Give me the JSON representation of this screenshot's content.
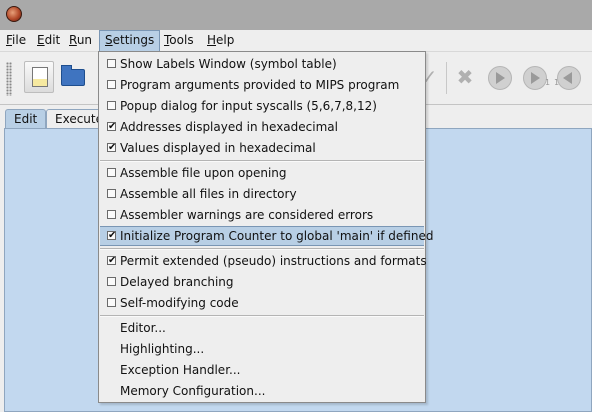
{
  "menubar": {
    "items": [
      {
        "label": "File",
        "mnemonic": "F",
        "rest": "ile"
      },
      {
        "label": "Edit",
        "mnemonic": "E",
        "rest": "dit"
      },
      {
        "label": "Run",
        "mnemonic": "R",
        "rest": "un"
      },
      {
        "label": "Settings",
        "mnemonic": "S",
        "rest": "ettings"
      },
      {
        "label": "Tools",
        "mnemonic": "T",
        "rest": "ools"
      },
      {
        "label": "Help",
        "mnemonic": "H",
        "rest": "elp"
      }
    ]
  },
  "toolbar": {
    "step_subscript_1": "1",
    "step_subscript_2": "1"
  },
  "tabs": [
    {
      "label": "Edit",
      "selected": true
    },
    {
      "label": "Execute",
      "selected": false
    }
  ],
  "settings_menu": {
    "group1": [
      {
        "label": "Show Labels Window (symbol table)",
        "checked": false
      },
      {
        "label": "Program arguments provided to MIPS program",
        "checked": false
      },
      {
        "label": "Popup dialog for input syscalls (5,6,7,8,12)",
        "checked": false
      },
      {
        "label": "Addresses displayed in hexadecimal",
        "checked": true
      },
      {
        "label": "Values displayed in hexadecimal",
        "checked": true
      }
    ],
    "group2": [
      {
        "label": "Assemble file upon opening",
        "checked": false
      },
      {
        "label": "Assemble all files in directory",
        "checked": false
      },
      {
        "label": "Assembler warnings are considered errors",
        "checked": false
      },
      {
        "label": "Initialize Program Counter to global 'main' if defined",
        "checked": true,
        "highlighted": true
      }
    ],
    "group3": [
      {
        "label": "Permit extended (pseudo) instructions and formats",
        "checked": true
      },
      {
        "label": "Delayed branching",
        "checked": false
      },
      {
        "label": "Self-modifying code",
        "checked": false
      }
    ],
    "group4": [
      {
        "label": "Editor..."
      },
      {
        "label": "Highlighting..."
      },
      {
        "label": "Exception Handler..."
      },
      {
        "label": "Memory Configuration..."
      }
    ]
  },
  "check_mark": "✔",
  "colors": {
    "selection": "#b8cfe5",
    "editor_background": "#c2d8ef",
    "titlebar": "#a9a9a9"
  }
}
